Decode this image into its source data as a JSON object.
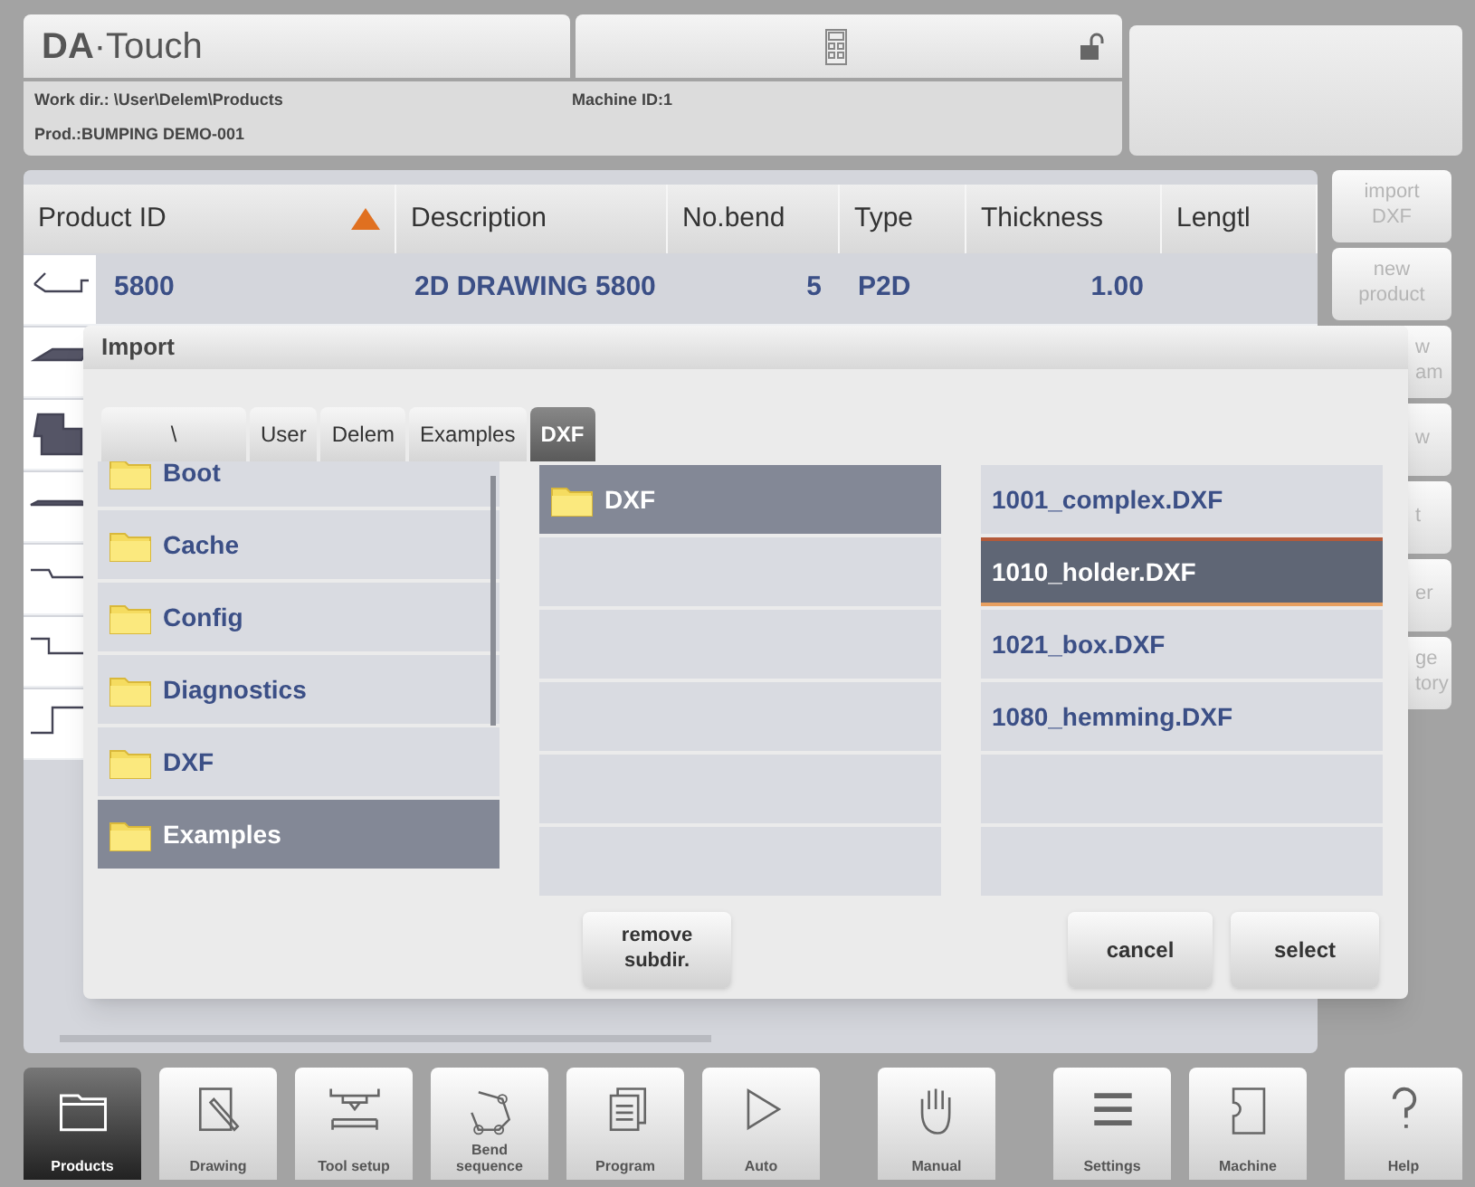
{
  "header": {
    "logo": "**DA**·Touch",
    "work_dir": "Work dir.: \\User\\Delem\\Products",
    "product": "Prod.:BUMPING DEMO-001",
    "machine_id": "Machine ID:1",
    "locked": false
  },
  "table": {
    "columns": [
      {
        "label": "Product ID",
        "sorted": true
      },
      {
        "label": "Description",
        "sorted": false
      },
      {
        "label": "No.bend",
        "sorted": false
      },
      {
        "label": "Type",
        "sorted": false
      },
      {
        "label": "Thickness",
        "sorted": false
      },
      {
        "label": "Lengtl",
        "sorted": false
      }
    ],
    "rows": [
      {
        "product_id": "5800",
        "description": "2D DRAWING 5800",
        "no_bend": "5",
        "type": "P2D",
        "thickness": "1.00"
      }
    ]
  },
  "side_buttons": [
    {
      "lines": [
        "import",
        "DXF"
      ],
      "partial": false,
      "disabled": true
    },
    {
      "lines": [
        "new",
        "product"
      ],
      "partial": false,
      "disabled": true
    },
    {
      "lines": [
        "w",
        "am"
      ],
      "partial": true,
      "disabled": true
    },
    {
      "lines": [
        "w"
      ],
      "partial": true,
      "disabled": true
    },
    {
      "lines": [
        "t"
      ],
      "partial": true,
      "disabled": true
    },
    {
      "lines": [
        "er"
      ],
      "partial": true,
      "disabled": true
    },
    {
      "lines": [
        "ge",
        "tory"
      ],
      "partial": true,
      "disabled": true
    }
  ],
  "dialog": {
    "title": "Import",
    "breadcrumb": [
      {
        "label": "\\",
        "selected": false
      },
      {
        "label": "User",
        "selected": false
      },
      {
        "label": "Delem",
        "selected": false
      },
      {
        "label": "Examples",
        "selected": false
      },
      {
        "label": "DXF",
        "selected": true
      }
    ],
    "folders": [
      {
        "name": "Boot",
        "selected": false
      },
      {
        "name": "Cache",
        "selected": false
      },
      {
        "name": "Config",
        "selected": false
      },
      {
        "name": "Diagnostics",
        "selected": false
      },
      {
        "name": "DXF",
        "selected": false
      },
      {
        "name": "Examples",
        "selected": true
      }
    ],
    "subdirs": [
      {
        "name": "DXF",
        "selected": true
      }
    ],
    "files": [
      {
        "name": "1001_complex.DXF",
        "selected": false
      },
      {
        "name": "1010_holder.DXF",
        "selected": true
      },
      {
        "name": "1021_box.DXF",
        "selected": false
      },
      {
        "name": "1080_hemming.DXF",
        "selected": false
      }
    ],
    "remove_button": [
      "remove",
      "subdir."
    ],
    "cancel_button": "cancel",
    "select_button": "select"
  },
  "toolbar": [
    [
      {
        "kind": "products",
        "label": "Products",
        "selected": true
      },
      {
        "kind": "drawing",
        "label": "Drawing",
        "selected": false
      },
      {
        "kind": "tool_setup",
        "label": "Tool setup",
        "selected": false
      },
      {
        "kind": "bend_sequence",
        "label": "Bend\nsequence",
        "selected": false
      },
      {
        "kind": "program",
        "label": "Program",
        "selected": false
      },
      {
        "kind": "auto",
        "label": "Auto",
        "selected": false
      }
    ],
    [
      {
        "kind": "manual",
        "label": "Manual",
        "selected": false
      }
    ],
    [
      {
        "kind": "settings",
        "label": "Settings",
        "selected": false
      },
      {
        "kind": "machine",
        "label": "Machine",
        "selected": false
      }
    ],
    [
      {
        "kind": "help",
        "label": "Help",
        "selected": false
      }
    ]
  ]
}
